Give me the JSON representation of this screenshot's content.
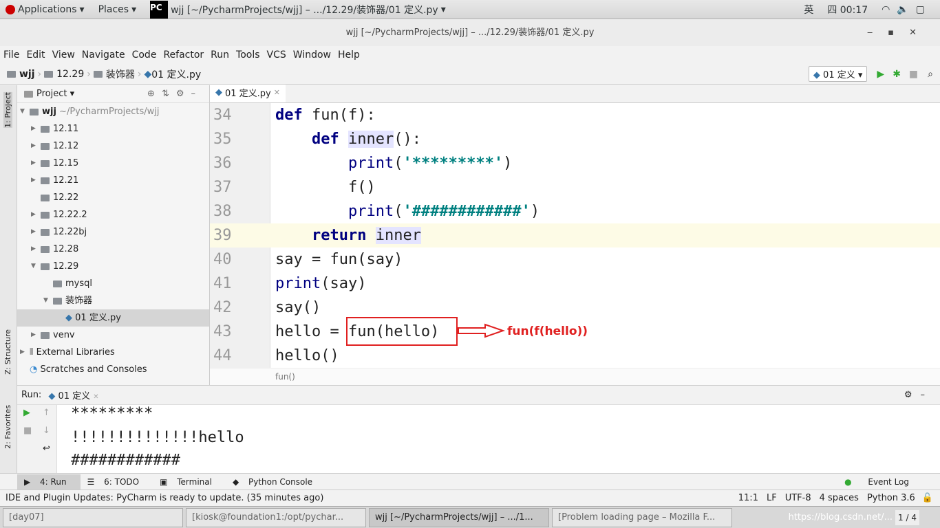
{
  "topbar": {
    "applications": "Applications",
    "places": "Places",
    "window_title": "wjj [~/PycharmProjects/wjj] – .../12.29/装饰器/01 定义.py",
    "input_method": "英",
    "clock": "四 00:17"
  },
  "window": {
    "title": "wjj [~/PycharmProjects/wjj] – .../12.29/装饰器/01 定义.py"
  },
  "menu": [
    "File",
    "Edit",
    "View",
    "Navigate",
    "Code",
    "Refactor",
    "Run",
    "Tools",
    "VCS",
    "Window",
    "Help"
  ],
  "breadcrumb": [
    "wjj",
    "12.29",
    "装饰器",
    "01 定义.py"
  ],
  "run_config": "01 定义",
  "sidebar_tabs": {
    "project": "1: Project",
    "structure": "Z: Structure",
    "favorites": "2: Favorites"
  },
  "project": {
    "title": "Project",
    "root": "wjj",
    "root_path": "~/PycharmProjects/wjj",
    "items": [
      {
        "label": "12.11"
      },
      {
        "label": "12.12"
      },
      {
        "label": "12.15"
      },
      {
        "label": "12.21"
      },
      {
        "label": "12.22"
      },
      {
        "label": "12.22.2"
      },
      {
        "label": "12.22bj"
      },
      {
        "label": "12.28"
      },
      {
        "label": "12.29"
      },
      {
        "label": "mysql"
      },
      {
        "label": "装饰器"
      },
      {
        "label": "01 定义.py"
      },
      {
        "label": "venv"
      },
      {
        "label": "External Libraries"
      },
      {
        "label": "Scratches and Consoles"
      }
    ]
  },
  "editor": {
    "tab": "01 定义.py",
    "breadcrumb": "fun()",
    "lines": [
      {
        "n": "34"
      },
      {
        "n": "35"
      },
      {
        "n": "36"
      },
      {
        "n": "37"
      },
      {
        "n": "38"
      },
      {
        "n": "39"
      },
      {
        "n": "40"
      },
      {
        "n": "41"
      },
      {
        "n": "42"
      },
      {
        "n": "43"
      },
      {
        "n": "44"
      }
    ],
    "code": {
      "l34a": "def",
      "l34b": " fun(f):",
      "l35a": "def",
      "l35b": "inner",
      "l35c": "():",
      "l36a": "print",
      "l36b": "(",
      "l36c": "'*********'",
      "l36d": ")",
      "l37": "f()",
      "l38a": "print",
      "l38b": "(",
      "l38c": "'############'",
      "l38d": ")",
      "l39a": "return",
      "l39b": "inner",
      "l40": "say = fun(say)",
      "l41a": "print",
      "l41b": "(say)",
      "l42": "say()",
      "l43a": "hello = ",
      "l43b": "fun(hello)",
      "l44": "hello()"
    }
  },
  "annotation": {
    "text": "fun(f(hello))",
    "color": "#e02020"
  },
  "run": {
    "label": "Run:",
    "tab": "01 定义",
    "output": [
      "*********",
      "!!!!!!!!!!!!!!hello",
      "############"
    ]
  },
  "toolwindows": [
    "4: Run",
    "6: TODO",
    "Terminal",
    "Python Console",
    "Event Log"
  ],
  "status": {
    "message": "IDE and Plugin Updates: PyCharm is ready to update. (35 minutes ago)",
    "position": "11:1",
    "line_sep": "LF",
    "encoding": "UTF-8",
    "indent": "4 spaces",
    "interpreter": "Python 3.6"
  },
  "taskbar": {
    "items": [
      "[day07]",
      "[kiosk@foundation1:/opt/pychar...",
      "wjj [~/PycharmProjects/wjj] – .../1...",
      "[Problem loading page – Mozilla F..."
    ],
    "pager": "1 / 4",
    "watermark": "https://blog.csdn.net/..."
  }
}
